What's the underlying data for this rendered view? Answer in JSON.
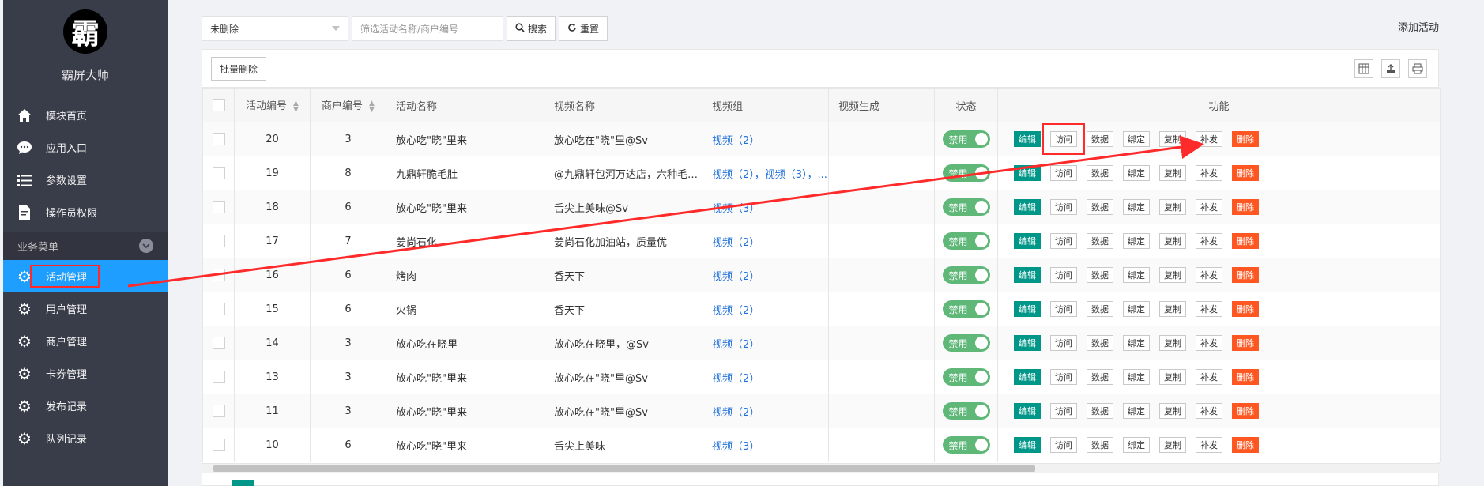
{
  "sidebar": {
    "logo_char": "霸",
    "brand": "霸屏大师",
    "top_items": [
      {
        "label": "模块首页",
        "icon": "home-icon"
      },
      {
        "label": "应用入口",
        "icon": "chat-icon"
      },
      {
        "label": "参数设置",
        "icon": "list-icon"
      },
      {
        "label": "操作员权限",
        "icon": "document-icon"
      }
    ],
    "group_label": "业务菜单",
    "group_items": [
      {
        "label": "活动管理",
        "active": true
      },
      {
        "label": "用户管理"
      },
      {
        "label": "商户管理"
      },
      {
        "label": "卡券管理"
      },
      {
        "label": "发布记录"
      },
      {
        "label": "队列记录"
      }
    ]
  },
  "toolbar": {
    "select_value": "未删除",
    "search_placeholder": "筛选活动名称/商户编号",
    "search_label": "搜索",
    "reset_label": "重置",
    "add_label": "添加活动"
  },
  "panel": {
    "bulk_delete_label": "批量删除"
  },
  "table": {
    "headers": {
      "activity_id": "活动编号",
      "merchant_id": "商户编号",
      "activity_name": "活动名称",
      "video_name": "视频名称",
      "video_group": "视频组",
      "video_gen": "视频生成",
      "status": "状态",
      "functions": "功能"
    },
    "status_label": "禁用",
    "ops": [
      "编辑",
      "访问",
      "数据",
      "绑定",
      "复制",
      "补发",
      "删除"
    ],
    "rows": [
      {
        "id": "20",
        "merchant": "3",
        "name": "放心吃\"晓\"里来",
        "video": "放心吃在\"晓\"里@Sv",
        "group": "视频（2）"
      },
      {
        "id": "19",
        "merchant": "8",
        "name": "九鼎轩脆毛肚",
        "video": "@九鼎轩包河万达店，六种毛肚...",
        "group": "视频（2），视频（3），..."
      },
      {
        "id": "18",
        "merchant": "6",
        "name": "放心吃\"晓\"里来",
        "video": "舌尖上美味@Sv",
        "group": "视频（3）"
      },
      {
        "id": "17",
        "merchant": "7",
        "name": "姜尚石化",
        "video": "姜尚石化加油站，质量优",
        "group": "视频（2）"
      },
      {
        "id": "16",
        "merchant": "6",
        "name": "烤肉",
        "video": "香天下",
        "group": "视频（2）"
      },
      {
        "id": "15",
        "merchant": "6",
        "name": "火锅",
        "video": "香天下",
        "group": "视频（2）"
      },
      {
        "id": "14",
        "merchant": "3",
        "name": "放心吃在晓里",
        "video": "放心吃在晓里，@Sv",
        "group": "视频（2）"
      },
      {
        "id": "13",
        "merchant": "3",
        "name": "放心吃\"晓\"里来",
        "video": "放心吃在\"晓\"里@Sv",
        "group": "视频（2）"
      },
      {
        "id": "11",
        "merchant": "3",
        "name": "放心吃\"晓\"里来",
        "video": "放心吃在\"晓\"里@Sv",
        "group": "视频（2）"
      },
      {
        "id": "10",
        "merchant": "6",
        "name": "放心吃\"晓\"里来",
        "video": "舌尖上美味",
        "group": "视频（3）"
      }
    ]
  },
  "colors": {
    "sidebar_bg": "#393d49",
    "active_bg": "#1e9fff",
    "edit_btn": "#009688",
    "delete_btn": "#ff5722",
    "toggle": "#5fb878",
    "annotation": "#ff2a2a"
  }
}
